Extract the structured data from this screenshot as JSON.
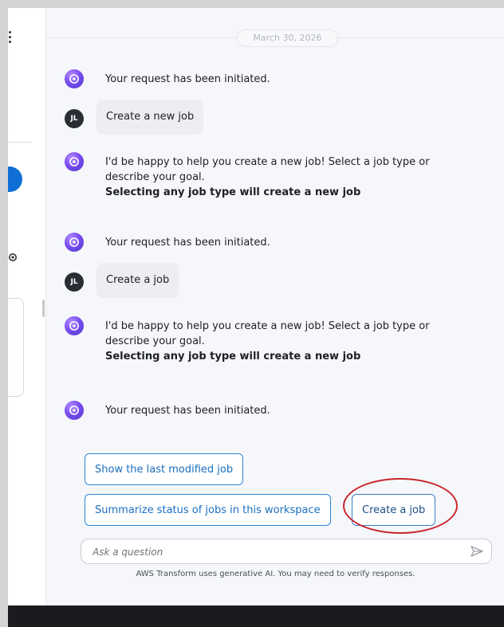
{
  "date_divider": "March 30, 2026",
  "messages": [
    {
      "sender": "ai",
      "text": "Your request has been initiated."
    },
    {
      "sender": "user",
      "initials": "JL",
      "text": "Create a new job"
    },
    {
      "sender": "ai",
      "text": "I'd be happy to help you create a new job! Select a job type or describe your goal.",
      "bold": "Selecting any job type will create a new job"
    },
    {
      "sender": "ai",
      "text": "Your request has been initiated."
    },
    {
      "sender": "user",
      "initials": "JL",
      "text": "Create a job"
    },
    {
      "sender": "ai",
      "text": "I'd be happy to help you create a new job! Select a job type or describe your goal.",
      "bold": "Selecting any job type will create a new job"
    },
    {
      "sender": "ai",
      "text": "Your request has been initiated."
    }
  ],
  "suggestions": {
    "last_modified": "Show the last modified job",
    "summarize": "Summarize status of jobs in this workspace",
    "create": "Create a job"
  },
  "input": {
    "placeholder": "Ask a question",
    "value": ""
  },
  "disclaimer": "AWS Transform uses generative AI. You may need to verify responses.",
  "colors": {
    "accent": "#2e86d6",
    "highlight_ring": "#c8262c",
    "ai_avatar": "#7a4df2",
    "user_avatar": "#2a2d33"
  }
}
